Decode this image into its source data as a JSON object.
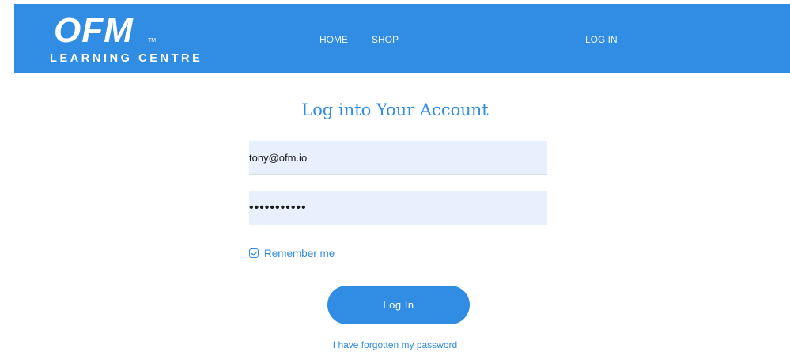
{
  "header": {
    "logo_mark": "OFM",
    "logo_tm": "TM",
    "logo_subtitle": "LEARNING CENTRE",
    "nav": {
      "home": "HOME",
      "shop": "SHOP",
      "login": "LOG IN"
    },
    "background_color": "#318ce3"
  },
  "login_form": {
    "title": "Log into Your Account",
    "email_value": "tony@ofm.io",
    "password_value": "•••••••••••",
    "remember_label": "Remember me",
    "remember_checked": true,
    "submit_label": "Log In",
    "forgot_link": "I have forgotten my password",
    "field_background": "#e8f0fe",
    "accent_color": "#318ce3"
  },
  "icons": {
    "checkbox": "check-icon"
  }
}
